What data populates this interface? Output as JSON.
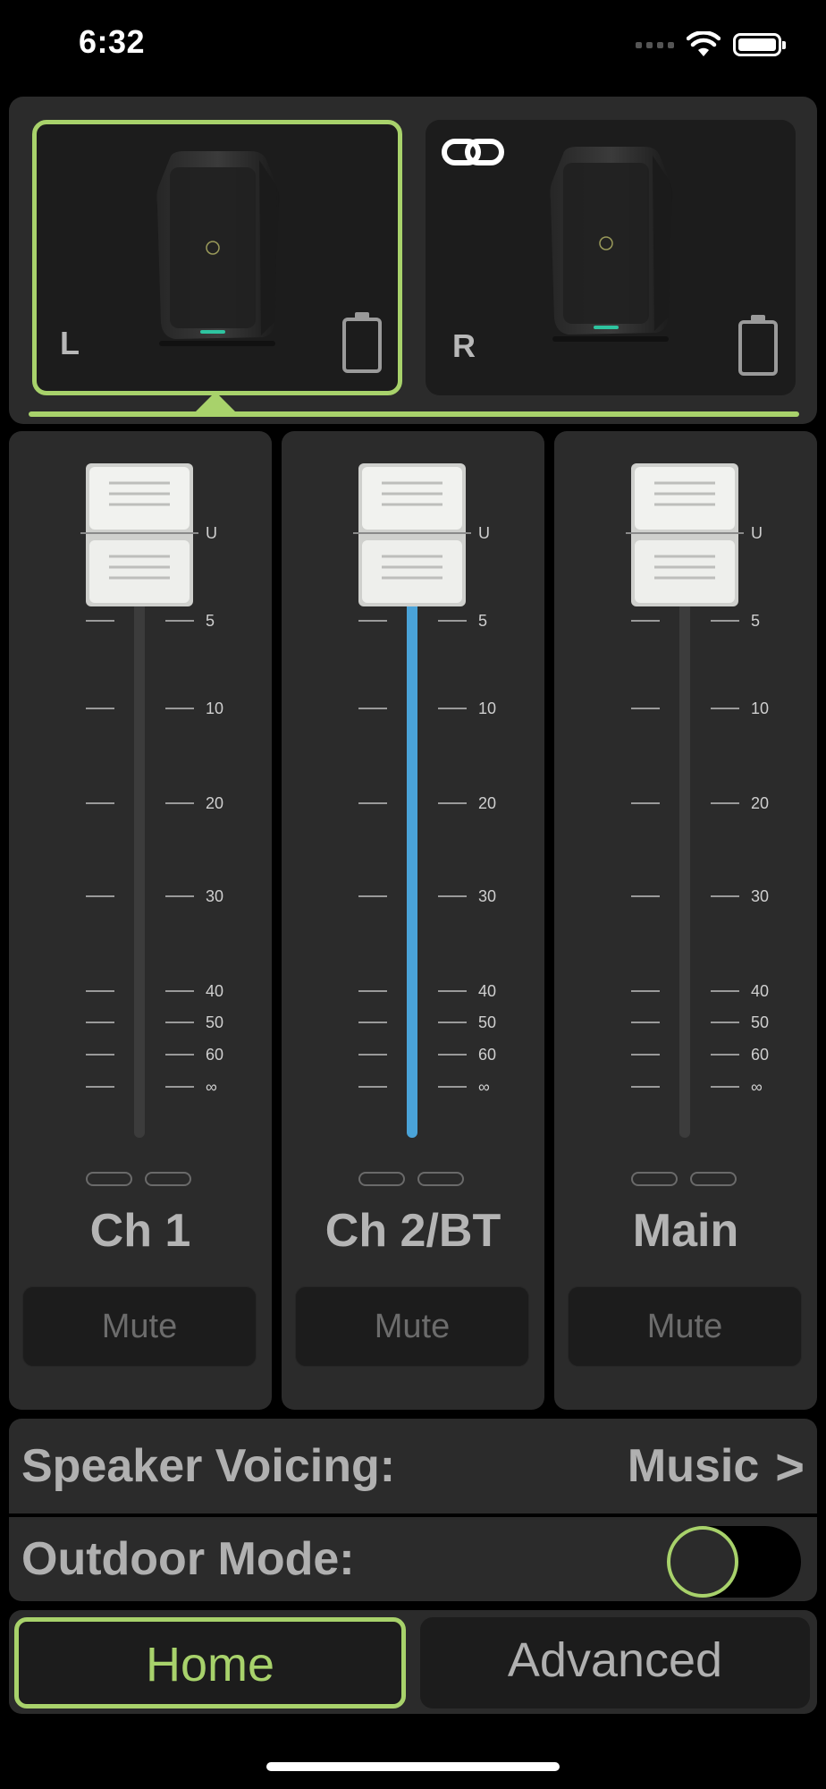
{
  "status_bar": {
    "time": "6:32"
  },
  "speakers": [
    {
      "side": "L",
      "selected": true
    },
    {
      "side": "R",
      "selected": false,
      "linked": true
    }
  ],
  "fader_scale": [
    "U",
    "5",
    "10",
    "20",
    "30",
    "40",
    "50",
    "60",
    "∞"
  ],
  "channels": [
    {
      "name": "Ch 1",
      "mute_label": "Mute",
      "level_label": "U"
    },
    {
      "name": "Ch 2/BT",
      "mute_label": "Mute",
      "level_label": "U"
    },
    {
      "name": "Main",
      "mute_label": "Mute",
      "level_label": "U"
    }
  ],
  "settings": {
    "voicing_label": "Speaker Voicing:",
    "voicing_value": "Music",
    "voicing_chevron": ">",
    "outdoor_label": "Outdoor Mode:",
    "outdoor_on": false
  },
  "tabs": {
    "home": "Home",
    "advanced": "Advanced",
    "active": "home"
  },
  "colors": {
    "accent": "#a8d26b",
    "active_fader": "#4aa3d8",
    "panel": "#2b2b2b",
    "card": "#1c1c1c"
  }
}
